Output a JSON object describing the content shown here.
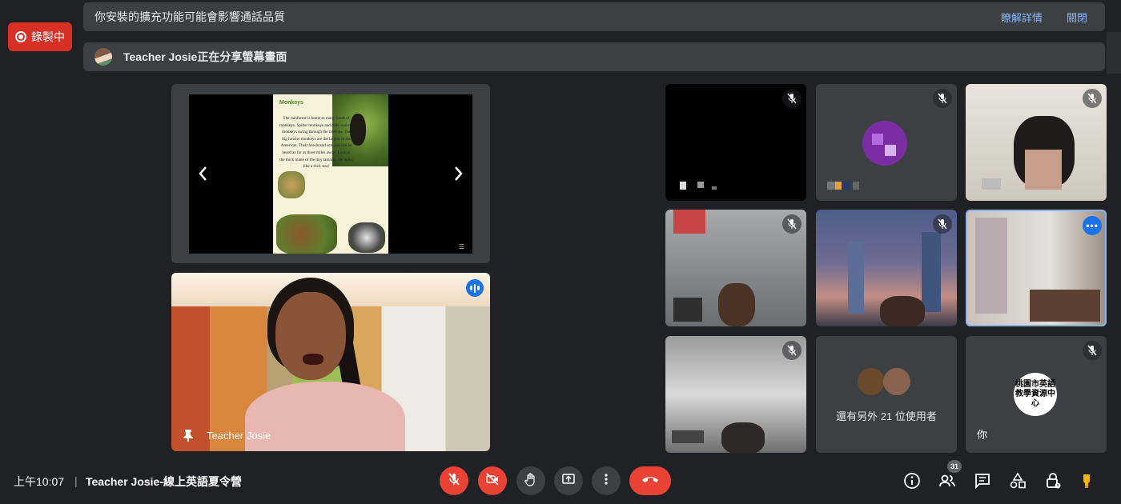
{
  "recording": {
    "label": "錄製中",
    "color": "#d93025"
  },
  "warning_banner": {
    "message": "你安裝的擴充功能可能會影響通話品質",
    "learn_more": "瞭解詳情",
    "close": "關閉"
  },
  "share_banner": {
    "message": "Teacher Josie正在分享螢幕畫面"
  },
  "slide": {
    "title": "Monkeys",
    "text": "The rainforest is home to many kinds of monkeys. Spider monkeys and little squirrel monkeys swing through the treetops. The big howler monkeys are the largest in the Americas. Their howls and screams can be heard as far as three miles away! Look at the thick mane of the tiny tamarin. He looks like a rock star!"
  },
  "presenter": {
    "name": "Teacher Josie"
  },
  "participants": {
    "others_label": "還有另外 21 位使用者",
    "self_label": "你",
    "self_logo": "桃園市英語教學資源中心"
  },
  "bottom_bar": {
    "time": "上午10:07",
    "separator": "|",
    "meeting_title": "Teacher Josie-線上英語夏令營",
    "people_count": "31"
  },
  "colors": {
    "accent_blue": "#1a73e8",
    "danger_red": "#ea4335",
    "link_blue": "#8ab4f8",
    "background": "#202124"
  }
}
